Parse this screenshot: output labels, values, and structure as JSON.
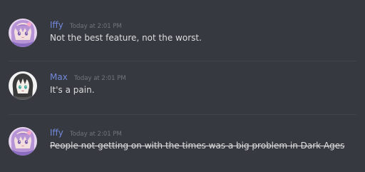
{
  "messages": [
    {
      "username": "Iffy",
      "timestamp": "Today at 2:01 PM",
      "content": "Not the best feature, not the worst.",
      "avatar_icon": "anime-girl-avatar",
      "name_color": "#7289da"
    },
    {
      "username": "Max",
      "timestamp": "Today at 2:01 PM",
      "content": "It's a pain.",
      "avatar_icon": "anime-character-avatar",
      "name_color": "#7289da"
    },
    {
      "username": "Iffy",
      "timestamp": "Today at 2:01 PM",
      "content": "People not getting on with the times was a big problem in Dark Ages",
      "avatar_icon": "anime-girl-avatar",
      "name_color": "#7289da",
      "strikethrough": true
    }
  ],
  "colors": {
    "background": "#36393f",
    "username": "#7289da",
    "timestamp": "#72767d",
    "text": "#dcddde"
  }
}
